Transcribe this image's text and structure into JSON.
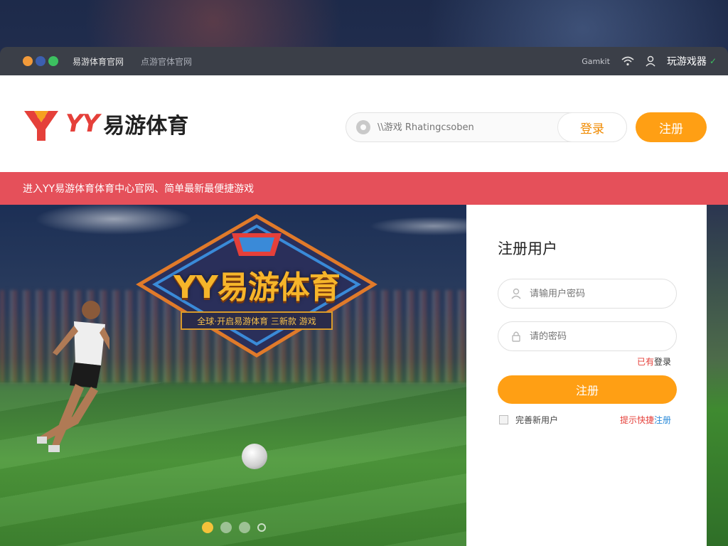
{
  "titlebar": {
    "title": "易游体育官网",
    "url": "点游官体官网",
    "network": "Gamkit",
    "user": "玩游戏器"
  },
  "header": {
    "logo_yy": "YY",
    "logo_cn": "易游体育",
    "search_placeholder": "\\\\游戏 Rhatingcsoben",
    "login_label": "登录",
    "register_label": "注册"
  },
  "notice": {
    "text": "进入YY易游体育体育中心官网、简单最新最便捷游戏"
  },
  "hero": {
    "badge_title": "YY易游体育",
    "badge_sub": "全球·开启易游体育 三新款 游戏",
    "carousel_dots": 4
  },
  "panel": {
    "title": "注册用户",
    "username_placeholder": "请输用户密码",
    "password_placeholder": "请的密码",
    "login_link_prefix": "已有",
    "login_link": "登录",
    "submit_label": "注册",
    "agree_label": "完善新用户",
    "quick_prefix": "提示快捷",
    "quick_link": "注册"
  },
  "colors": {
    "accent_orange": "#ff9f14",
    "brand_red": "#e5403a",
    "notice_red": "#e5505a"
  }
}
